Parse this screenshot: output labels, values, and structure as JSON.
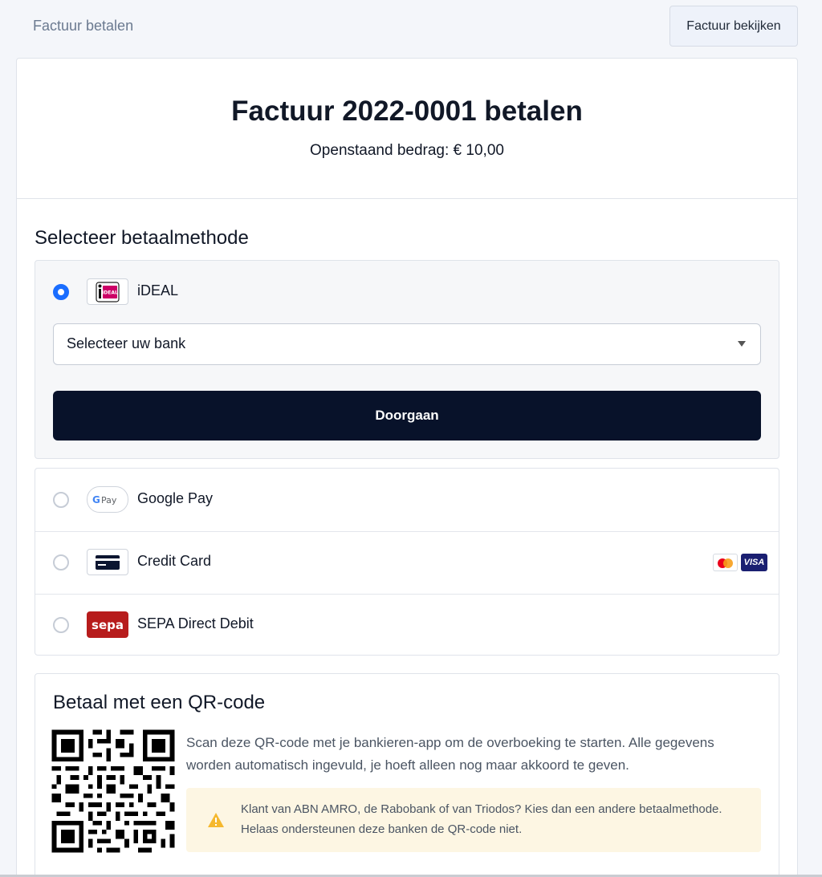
{
  "topbar": {
    "title": "Factuur betalen",
    "view_invoice_label": "Factuur bekijken"
  },
  "invoice": {
    "title": "Factuur 2022-0001 betalen",
    "outstanding": "Openstaand bedrag: € 10,00"
  },
  "payment": {
    "section_title": "Selecteer betaalmethode",
    "selected_method": "iDEAL",
    "methods": [
      {
        "label": "iDEAL",
        "icon": "ideal-logo",
        "selected": true
      },
      {
        "label": "Google Pay",
        "icon": "google-pay-logo",
        "selected": false
      },
      {
        "label": "Credit Card",
        "icon": "credit-card-icon",
        "selected": false,
        "brands": [
          "mastercard",
          "visa"
        ]
      },
      {
        "label": "SEPA Direct Debit",
        "icon": "sepa-logo",
        "selected": false
      }
    ],
    "bank_select_value": "Selecteer uw bank",
    "continue_label": "Doorgaan"
  },
  "qr": {
    "title": "Betaal met een QR-code",
    "description": "Scan deze QR-code met je bankieren-app om de overboeking te starten. Alle gegevens worden automatisch ingevuld, je hoeft alleen nog maar akkoord te geven.",
    "warning": "Klant van ABN AMRO, de Rabobank of van Triodos? Kies dan een andere betaalmethode. Helaas ondersteunen deze banken de QR-code niet."
  },
  "colors": {
    "accent": "#1a6dff",
    "primary_button": "#08122a",
    "warning_bg": "#fdf6e3",
    "warning_icon": "#f5b82e"
  }
}
